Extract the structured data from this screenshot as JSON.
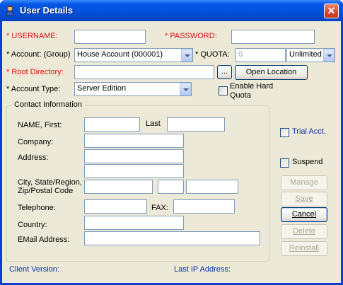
{
  "window": {
    "title": "User Details",
    "close_glyph": "✕"
  },
  "labels": {
    "username": "* USERNAME:",
    "password": "* PASSWORD:",
    "account_group": "* Account: (Group)",
    "quota": "* QUOTA:",
    "root_directory": "* Root Directory:",
    "account_type": "* Account Type:",
    "enable_hard_quota_1": "Enable Hard",
    "enable_hard_quota_2": "Quota",
    "contact_info": "Contact Information",
    "name_first": "NAME, First:",
    "last": "Last",
    "company": "Company:",
    "address": "Address:",
    "city_1": "City, State/Region,",
    "city_2": "Zip/Postal Code",
    "telephone": "Telephone:",
    "fax": "FAX:",
    "country": "Country:",
    "email": "EMail Address:",
    "trial_acct": "Trial Acct.",
    "suspend": "Suspend",
    "client_version": "Client Version:",
    "last_ip": "Last IP Address:"
  },
  "fields": {
    "username": "",
    "password": "",
    "account_group": "House Account (000001)",
    "quota_value": "0",
    "quota_unit": "Unlimited",
    "root_directory": "",
    "account_type": "Server Edition",
    "first_name": "",
    "last_name": "",
    "company": "",
    "address1": "",
    "address2": "",
    "city": "",
    "state": "",
    "zip": "",
    "telephone": "",
    "fax": "",
    "country": "",
    "email": ""
  },
  "buttons": {
    "browse": "...",
    "open_location": "Open Location",
    "manage": "Manage",
    "save": "Save",
    "cancel": "Cancel",
    "delete": "Delete",
    "reinstall": "Reinstall"
  },
  "checks": {
    "enable_hard_quota": false,
    "trial_acct": false,
    "suspend": false
  },
  "colors": {
    "required_label": "#e01010",
    "info_label": "#0a2ea8",
    "titlebar": "#0350d8",
    "dialog_bg": "#ece9d8"
  }
}
